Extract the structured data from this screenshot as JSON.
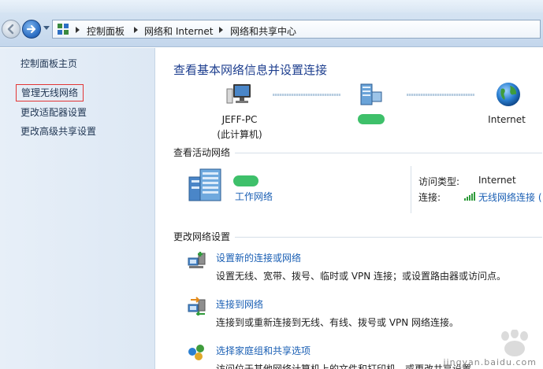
{
  "address_bar": {
    "breadcrumbs": [
      "控制面板",
      "网络和 Internet",
      "网络和共享中心"
    ]
  },
  "left_pane": {
    "links": [
      "控制面板主页",
      "管理无线网络",
      "更改适配器设置",
      "更改高级共享设置"
    ]
  },
  "main": {
    "title": "查看基本网络信息并设置连接",
    "map": {
      "computer_name": "JEFF-PC",
      "computer_note": "(此计算机)",
      "internet_label": "Internet"
    },
    "active_networks": {
      "label": "查看活动网络",
      "network_type": "工作网络",
      "access_type_key": "访问类型:",
      "access_type_value": "Internet",
      "connection_key": "连接:",
      "connection_value": "无线网络连接 ("
    },
    "change_settings": {
      "label": "更改网络设置",
      "tasks": [
        {
          "link": "设置新的连接或网络",
          "desc": "设置无线、宽带、拨号、临时或 VPN 连接；或设置路由器或访问点。"
        },
        {
          "link": "连接到网络",
          "desc": "连接到或重新连接到无线、有线、拨号或 VPN 网络连接。"
        },
        {
          "link": "选择家庭组和共享选项",
          "desc": "访问位于其他网络计算机上的文件和打印机，或更改共享设置"
        }
      ]
    }
  },
  "watermark": {
    "text": "jingyan.baidu.com"
  },
  "colors": {
    "link": "#1a5fb4",
    "title": "#1e3f8f",
    "highlight_box": "#e23636",
    "left_pane_bg": "#dde8f4"
  }
}
